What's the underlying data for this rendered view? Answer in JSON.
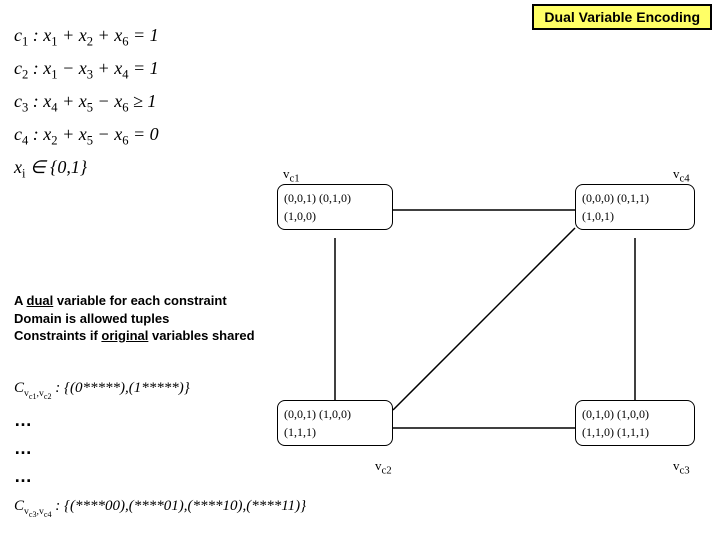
{
  "badge": "Dual Variable Encoding",
  "constraints": {
    "c1": "c₁ : x₁ + x₂ + x₆ = 1",
    "c2": "c₂ : x₁ − x₃ + x₄ = 1",
    "c3": "c₃ : x₄ + x₅ − x₆ ≥ 1",
    "c4": "c₄ : x₂ + x₅ − x₆ = 0",
    "xi": "xᵢ ∈ {0,1}"
  },
  "desc": {
    "l1a": "A ",
    "l1b": "dual",
    "l1c": " variable for each constraint",
    "l2": "Domain is allowed tuples",
    "l3a": "Constraints if ",
    "l3b": "original",
    "l3c": " variables shared"
  },
  "nodes": {
    "vc1": {
      "label": "v_c1",
      "r1": "(0,0,1) (0,1,0)",
      "r2": "(1,0,0)"
    },
    "vc4": {
      "label": "v_c4",
      "r1": "(0,0,0) (0,1,1)",
      "r2": "(1,0,1)"
    },
    "vc2": {
      "label": "v_c2",
      "r1": "(0,0,1) (1,0,0)",
      "r2": "(1,1,1)"
    },
    "vc3": {
      "label": "v_c3",
      "r1": "(0,1,0) (1,0,0)",
      "r2": "(1,1,0) (1,1,1)"
    }
  },
  "deriv": {
    "d1": "C_{v_{c1},v_{c2}} : {(0*****),(1*****)}",
    "dots": "…",
    "d2": "C_{v_{c3},v_{c4}} : {(****00),(****01),(****10),(****11)}"
  },
  "chart_data": {
    "type": "diagram",
    "title": "Dual Variable Encoding",
    "constraints": [
      {
        "id": "c1",
        "expr": "x1 + x2 + x6 = 1"
      },
      {
        "id": "c2",
        "expr": "x1 - x3 + x4 = 1"
      },
      {
        "id": "c3",
        "expr": "x4 + x5 - x6 >= 1"
      },
      {
        "id": "c4",
        "expr": "x2 + x5 - x6 = 0"
      }
    ],
    "domain": "xi in {0,1}",
    "dual_nodes": [
      {
        "id": "vc1",
        "tuples": [
          "(0,0,1)",
          "(0,1,0)",
          "(1,0,0)"
        ]
      },
      {
        "id": "vc2",
        "tuples": [
          "(0,0,1)",
          "(1,0,0)",
          "(1,1,1)"
        ]
      },
      {
        "id": "vc3",
        "tuples": [
          "(0,1,0)",
          "(1,0,0)",
          "(1,1,0)",
          "(1,1,1)"
        ]
      },
      {
        "id": "vc4",
        "tuples": [
          "(0,0,0)",
          "(0,1,1)",
          "(1,0,1)"
        ]
      }
    ],
    "edges": [
      [
        "vc1",
        "vc4"
      ],
      [
        "vc1",
        "vc2"
      ],
      [
        "vc2",
        "vc3"
      ],
      [
        "vc3",
        "vc4"
      ],
      [
        "vc2",
        "vc4"
      ]
    ],
    "dual_constraints": [
      {
        "between": [
          "vc1",
          "vc2"
        ],
        "tuples": [
          "(0*****)",
          "(1*****)"
        ]
      },
      {
        "between": [
          "vc3",
          "vc4"
        ],
        "tuples": [
          "(****00)",
          "(****01)",
          "(****10)",
          "(****11)"
        ]
      }
    ]
  }
}
